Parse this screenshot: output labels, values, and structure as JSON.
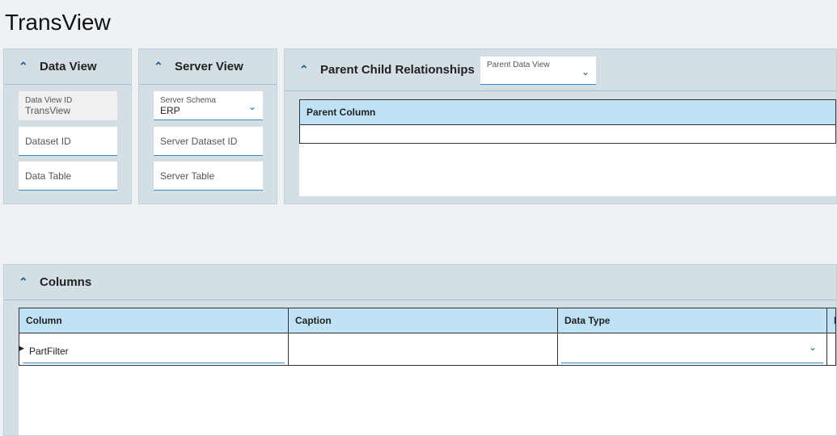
{
  "app": {
    "title": "TransView"
  },
  "data_view": {
    "header": "Data View",
    "id_label": "Data View ID",
    "id_value": "TransView",
    "dataset_id": "Dataset ID",
    "data_table": "Data Table"
  },
  "server_view": {
    "header": "Server View",
    "schema_label": "Server Schema",
    "schema_value": "ERP",
    "dataset_id": "Server Dataset ID",
    "table": "Server Table"
  },
  "relationships": {
    "header": "Parent Child Relationships",
    "parent_dv_label": "Parent Data View",
    "columns": [
      "Parent Column"
    ]
  },
  "columns": {
    "header": "Columns",
    "headers": [
      "Column",
      "Caption",
      "Data Type",
      "Format"
    ],
    "rows": [
      {
        "column": "PartFilter",
        "caption": "",
        "data_type": "",
        "format": ""
      }
    ]
  }
}
